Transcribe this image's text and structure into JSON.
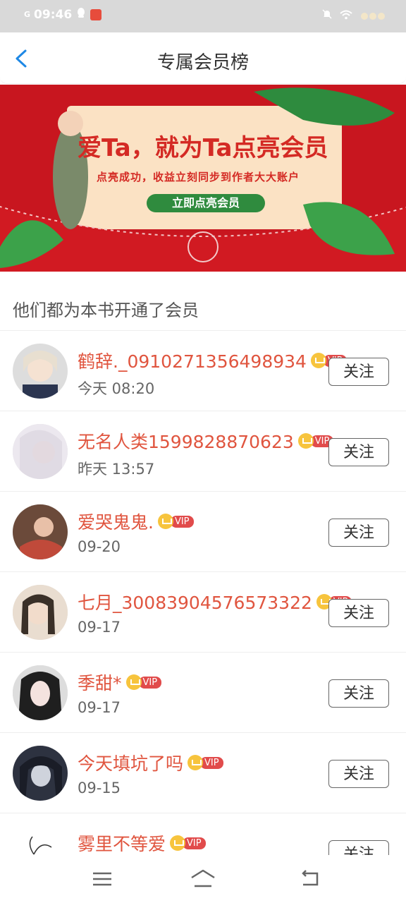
{
  "status_bar": {
    "signal": "G",
    "time": "09:46",
    "right_icons": [
      "mute-icon",
      "wifi-icon",
      "flowers"
    ]
  },
  "header": {
    "title": "专属会员榜"
  },
  "banner": {
    "headline": "爱Ta，就为Ta点亮会员",
    "subline": "点亮成功，收益立刻同步到作者大大账户",
    "cta": "立即点亮会员"
  },
  "section": {
    "label": "他们都为本书开通了会员"
  },
  "members": [
    {
      "name": "鹤辞._0910271356498934",
      "time": "今天 08:20",
      "vip": "VIP",
      "follow": "关注"
    },
    {
      "name": "无名人类1599828870623",
      "time": "昨天 13:57",
      "vip": "VIP",
      "follow": "关注"
    },
    {
      "name": "爱哭鬼鬼.",
      "time": "09-20",
      "vip": "VIP",
      "follow": "关注"
    },
    {
      "name": "七月_30083904576573322",
      "time": "09-17",
      "vip": "VIP",
      "follow": "关注"
    },
    {
      "name": "季甜*",
      "time": "09-17",
      "vip": "VIP",
      "follow": "关注"
    },
    {
      "name": "今天填坑了吗",
      "time": "09-15",
      "vip": "VIP",
      "follow": "关注"
    },
    {
      "name": "雾里不等爱",
      "time": "",
      "vip": "VIP",
      "follow": "关注"
    }
  ],
  "colors": {
    "accent": "#e0553f",
    "banner": "#c8161f",
    "vip": "#e14b4b",
    "crown": "#f7c43d"
  }
}
